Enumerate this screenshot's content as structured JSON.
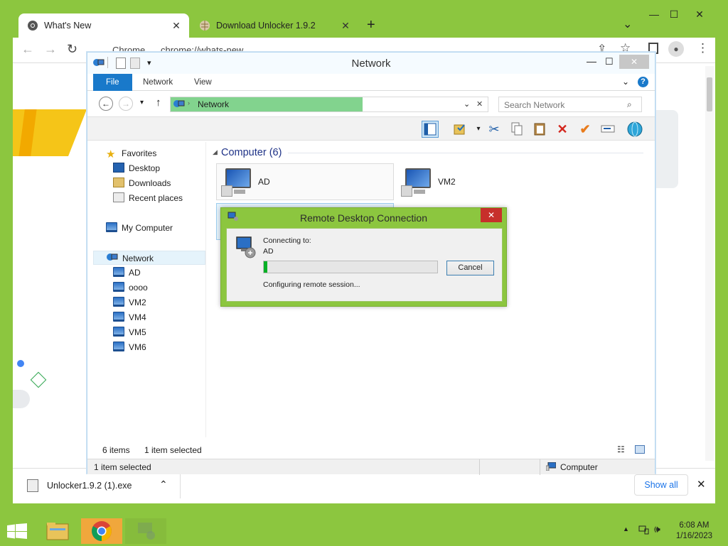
{
  "chrome": {
    "tabs": [
      {
        "label": "What's New",
        "active": true
      },
      {
        "label": "Download Unlocker 1.9.2",
        "active": false
      }
    ],
    "new_tab": "+",
    "tab_menu": "⌄",
    "address_label": "Chrome",
    "address_url": "chrome://whats-new",
    "download_bar": {
      "filename": "Unlocker1.9.2 (1).exe",
      "show_all": "Show all",
      "close": "✕"
    }
  },
  "explorer": {
    "title": "Network",
    "ribbon_tabs": [
      "File",
      "Network",
      "View"
    ],
    "breadcrumb": "Network",
    "search_placeholder": "Search Network",
    "nav": {
      "favorites": "Favorites",
      "favorites_items": [
        "Desktop",
        "Downloads",
        "Recent places"
      ],
      "my_computer": "My Computer",
      "network": "Network",
      "network_items": [
        "AD",
        "oooo",
        "VM2",
        "VM4",
        "VM5",
        "VM6"
      ]
    },
    "group_header": "Computer (6)",
    "computers": [
      "AD",
      "VM2"
    ],
    "status_items": "6 items",
    "status_selected": "1 item selected",
    "details_selected": "1 item selected",
    "details_location": "Computer"
  },
  "rdc": {
    "title": "Remote Desktop Connection",
    "close": "✕",
    "connecting_to_label": "Connecting to:",
    "target": "AD",
    "progress_percent": 2,
    "status": "Configuring remote session...",
    "cancel": "Cancel"
  },
  "taskbar": {
    "time": "6:08 AM",
    "date": "1/16/2023"
  },
  "colors": {
    "accent_green": "#8cc63f",
    "file_tab_blue": "#1979ca",
    "progress_green": "#06b025",
    "close_red": "#c7302b"
  }
}
